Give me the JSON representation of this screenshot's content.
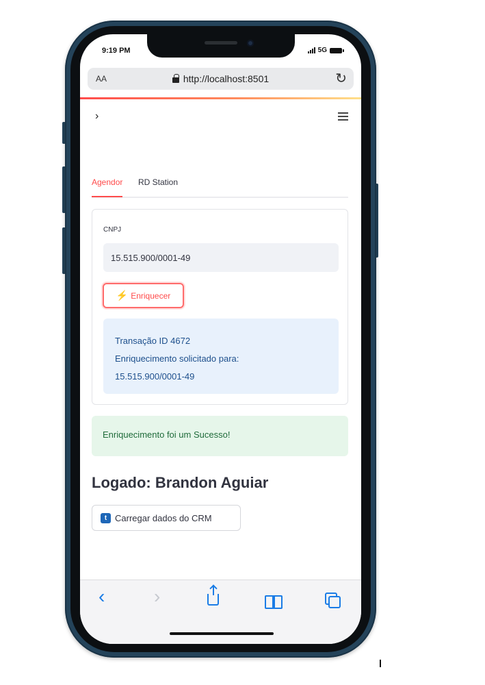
{
  "status_bar": {
    "time": "9:19 PM",
    "network": "5G"
  },
  "browser": {
    "text_size_label": "AA",
    "url": "http://localhost:8501"
  },
  "tabs": [
    {
      "label": "Agendor",
      "active": true
    },
    {
      "label": "RD Station",
      "active": false
    }
  ],
  "form": {
    "cnpj_label": "CNPJ",
    "cnpj_value": "15.515.900/0001-49",
    "enrich_button": "Enriquecer",
    "info_line1": "Transação ID 4672",
    "info_line2": "Enriquecimento solicitado para:",
    "info_line3": "15.515.900/0001-49"
  },
  "success_message": "Enriquecimento foi um Sucesso!",
  "logged_user": "Logado: Brandon Aguiar",
  "crm_button": {
    "icon_text": "t",
    "label": "Carregar dados do CRM"
  },
  "colors": {
    "accent": "#ff4b4b",
    "info_bg": "#e8f1fc",
    "success_bg": "#e6f6ea",
    "safari_blue": "#1a7ce6",
    "phone_frame": "#24435a"
  }
}
